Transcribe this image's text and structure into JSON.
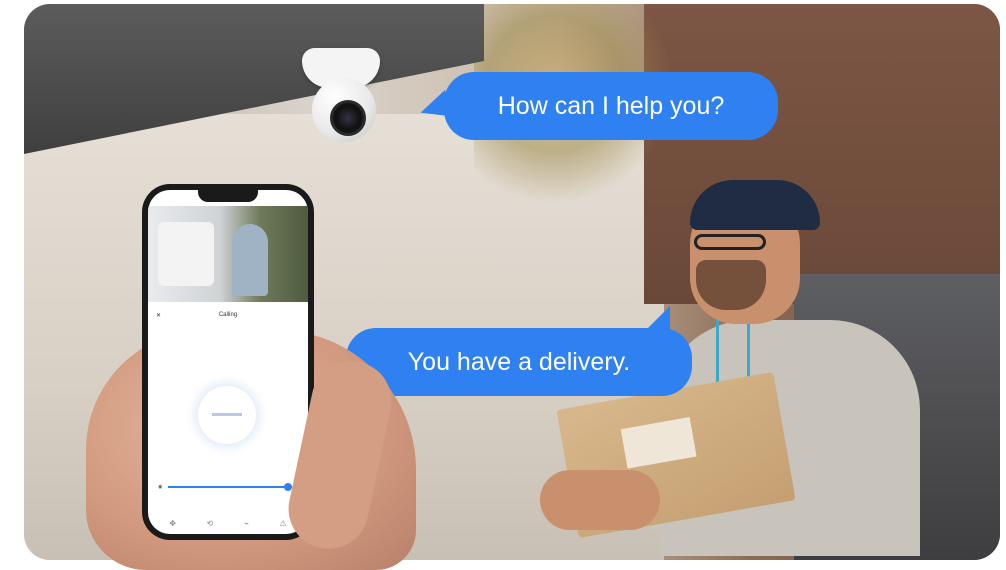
{
  "bubbles": {
    "camera_speech": "How can I help you?",
    "courier_speech": "You have a delivery."
  },
  "colors": {
    "bubble_blue": "#2f80f0"
  },
  "phone": {
    "call_title": "Calling",
    "icons": [
      "close-icon",
      "speaker-icon",
      "move-icon",
      "pan-icon",
      "talk-icon",
      "alarm-icon"
    ]
  }
}
